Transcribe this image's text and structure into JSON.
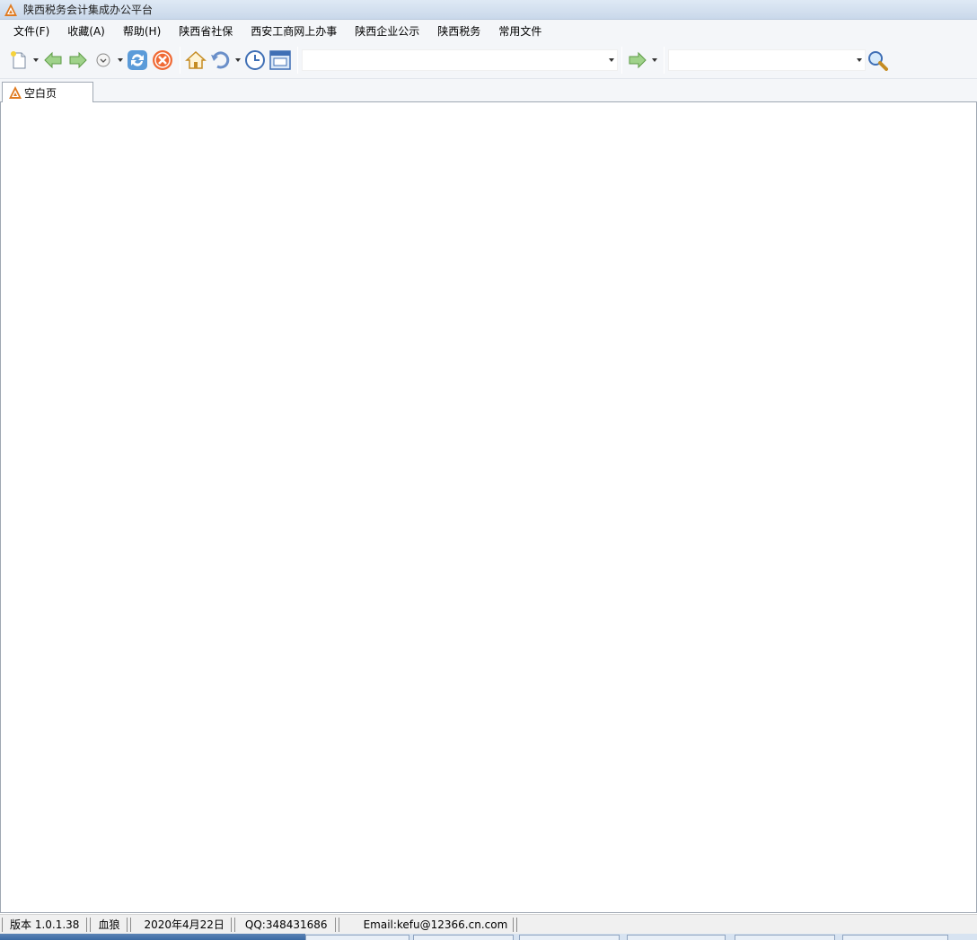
{
  "window": {
    "title": "陕西税务会计集成办公平台"
  },
  "menu": [
    {
      "label": "文件(F)"
    },
    {
      "label": "收藏(A)"
    },
    {
      "label": "帮助(H)"
    },
    {
      "label": "陕西省社保"
    },
    {
      "label": "西安工商网上办事"
    },
    {
      "label": "陕西企业公示"
    },
    {
      "label": "陕西税务"
    },
    {
      "label": "常用文件"
    }
  ],
  "toolbar": {
    "address": {
      "value": ""
    },
    "search": {
      "value": ""
    }
  },
  "tabs": [
    {
      "label": "空白页",
      "active": true
    }
  ],
  "status": {
    "version": "版本 1.0.1.38",
    "user": "血狼",
    "date": "2020年4月22日",
    "qq": "QQ:348431686",
    "email": "Email:kefu@12366.cn.com"
  },
  "colors": {
    "accent": "#e07b20",
    "menu_bg": "#f4f6f9",
    "border": "#a0a8b3"
  }
}
